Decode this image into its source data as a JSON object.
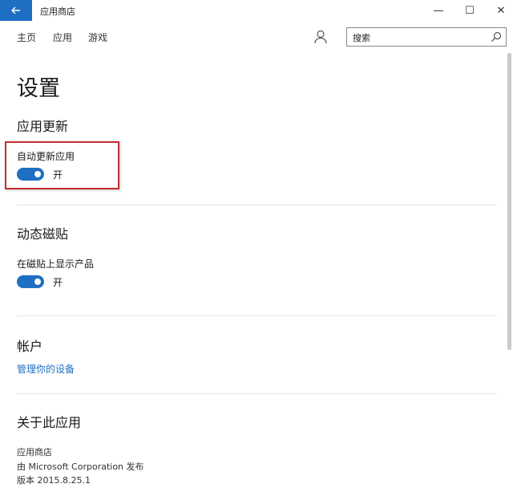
{
  "titlebar": {
    "title": "应用商店",
    "back_icon": "back-arrow-icon",
    "minimize": "—",
    "maximize": "☐",
    "close": "✕"
  },
  "nav": {
    "home": "主页",
    "apps": "应用",
    "games": "游戏"
  },
  "search": {
    "value": "搜索"
  },
  "page": {
    "title": "设置"
  },
  "sections": {
    "app_updates": {
      "title": "应用更新",
      "setting_label": "自动更新应用",
      "toggle_state": "开"
    },
    "live_tile": {
      "title": "动态磁贴",
      "setting_label": "在磁贴上显示产品",
      "toggle_state": "开"
    },
    "account": {
      "title": "帐户",
      "link": "管理你的设备"
    },
    "about": {
      "title": "关于此应用",
      "app_name": "应用商店",
      "publisher": "由 Microsoft Corporation 发布",
      "version": "版本 2015.8.25.1"
    }
  },
  "colors": {
    "accent": "#1e6fc4",
    "highlight_border": "#c03030"
  }
}
